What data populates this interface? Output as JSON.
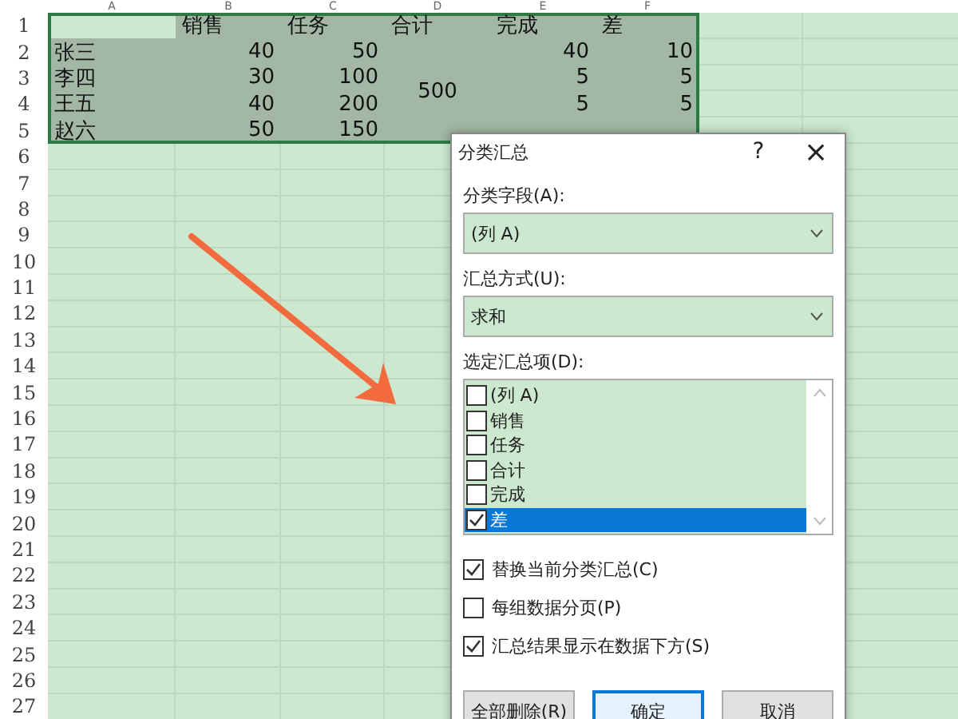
{
  "sheet": {
    "column_letters": [
      "A",
      "B",
      "C",
      "D",
      "E",
      "F"
    ],
    "row_numbers": [
      "1",
      "2",
      "3",
      "4",
      "5",
      "6",
      "7",
      "8",
      "9",
      "10",
      "11",
      "12",
      "13",
      "14",
      "15",
      "16",
      "17",
      "18",
      "19",
      "20",
      "21",
      "22",
      "23",
      "24",
      "25",
      "26",
      "27"
    ],
    "selected": true,
    "headers": [
      "销售",
      "任务",
      "合计",
      "完成",
      "差"
    ],
    "rows": [
      {
        "name": "张三",
        "sales": "40",
        "task": "50",
        "done": "40",
        "diff": "10"
      },
      {
        "name": "李四",
        "sales": "30",
        "task": "100",
        "done": "5",
        "diff": "5"
      },
      {
        "name": "王五",
        "sales": "40",
        "task": "200",
        "done": "5",
        "diff": "5"
      },
      {
        "name": "赵六",
        "sales": "50",
        "task": "150"
      }
    ],
    "merged_total": "500"
  },
  "dialog": {
    "title": "分类汇总",
    "help": "?",
    "close": "×",
    "field_label": "分类字段(A):",
    "field_value": "(列 A)",
    "method_label": "汇总方式(U):",
    "method_value": "求和",
    "items_label": "选定汇总项(D):",
    "items": [
      {
        "label": "(列 A)",
        "checked": false,
        "selected": false
      },
      {
        "label": "销售",
        "checked": false,
        "selected": false
      },
      {
        "label": "任务",
        "checked": false,
        "selected": false
      },
      {
        "label": "合计",
        "checked": false,
        "selected": false
      },
      {
        "label": "完成",
        "checked": false,
        "selected": false
      },
      {
        "label": "差",
        "checked": true,
        "selected": true
      }
    ],
    "options": [
      {
        "label": "替换当前分类汇总(C)",
        "checked": true
      },
      {
        "label": "每组数据分页(P)",
        "checked": false
      },
      {
        "label": "汇总结果显示在数据下方(S)",
        "checked": true
      }
    ],
    "buttons": [
      {
        "label": "全部删除(R)",
        "default": false
      },
      {
        "label": "确定",
        "default": true
      },
      {
        "label": "取消",
        "default": false
      }
    ]
  }
}
